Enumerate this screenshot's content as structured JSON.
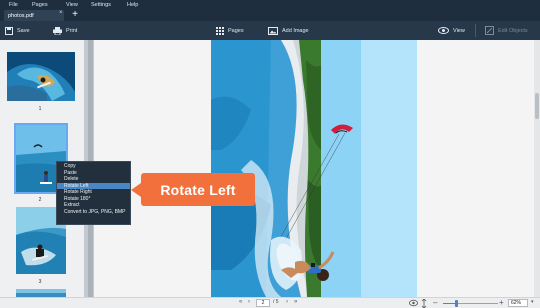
{
  "menu": {
    "file": "File",
    "pages": "Pages",
    "view": "View",
    "settings": "Settings",
    "help": "Help"
  },
  "tabs": [
    {
      "label": "photos.pdf",
      "close": "×"
    }
  ],
  "tab_add": "+",
  "toolbar": {
    "save": "Save",
    "print": "Print",
    "pages": "Pages",
    "add_image": "Add Image",
    "view": "View",
    "edit_objects": "Edit Objects"
  },
  "thumbnails": {
    "page1": "1",
    "page2": "2",
    "page3": "3"
  },
  "context_menu": {
    "copy": "Copy",
    "paste": "Paste",
    "delete": "Delete",
    "rotate_left": "Rotate Left",
    "rotate_right": "Rotate Right",
    "rotate_180": "Rotate 180°",
    "extract": "Extract",
    "convert": "Convert to JPG, PNG, BMP"
  },
  "callout": "Rotate Left",
  "status": {
    "current_page": "2",
    "total_pages": "/ 5",
    "zoom": "62%",
    "zoom_level": 0.24
  },
  "colors": {
    "menubar": "#1e2e3e",
    "toolbar": "#263849",
    "accent": "#4a86c4",
    "callout": "#f2703b"
  }
}
